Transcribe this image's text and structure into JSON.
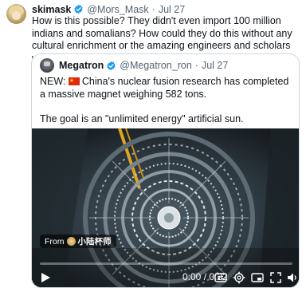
{
  "post": {
    "display_name": "skimask",
    "handle": "@Mors_Mask",
    "separator": "·",
    "date": "Jul 27",
    "text": "How is this possible? They didn't even import 100 million indians and somalians? How could they do this without any cultural enrichment or the amazing engineers and scholars we keep importing?"
  },
  "quoted": {
    "display_name": "Megatron",
    "handle": "@Megatron_ron",
    "separator": "·",
    "date": "Jul 27",
    "lines": [
      "NEW: China's nuclear fusion research has completed a massive magnet weighing 582 tons.",
      "",
      "The goal is an \"unlimited energy\" artificial sun.",
      "..."
    ],
    "flag_icon": "china-flag-icon"
  },
  "video": {
    "from_label": "From",
    "source": "小陆杯师",
    "time": "0:00 / 0:22",
    "progress": 0.0,
    "accent": "#1d9bf0"
  },
  "icons": [
    "verified-badge-icon",
    "play-icon",
    "captions-icon",
    "settings-gear-icon",
    "picture-in-picture-icon",
    "fullscreen-icon",
    "volume-icon"
  ]
}
